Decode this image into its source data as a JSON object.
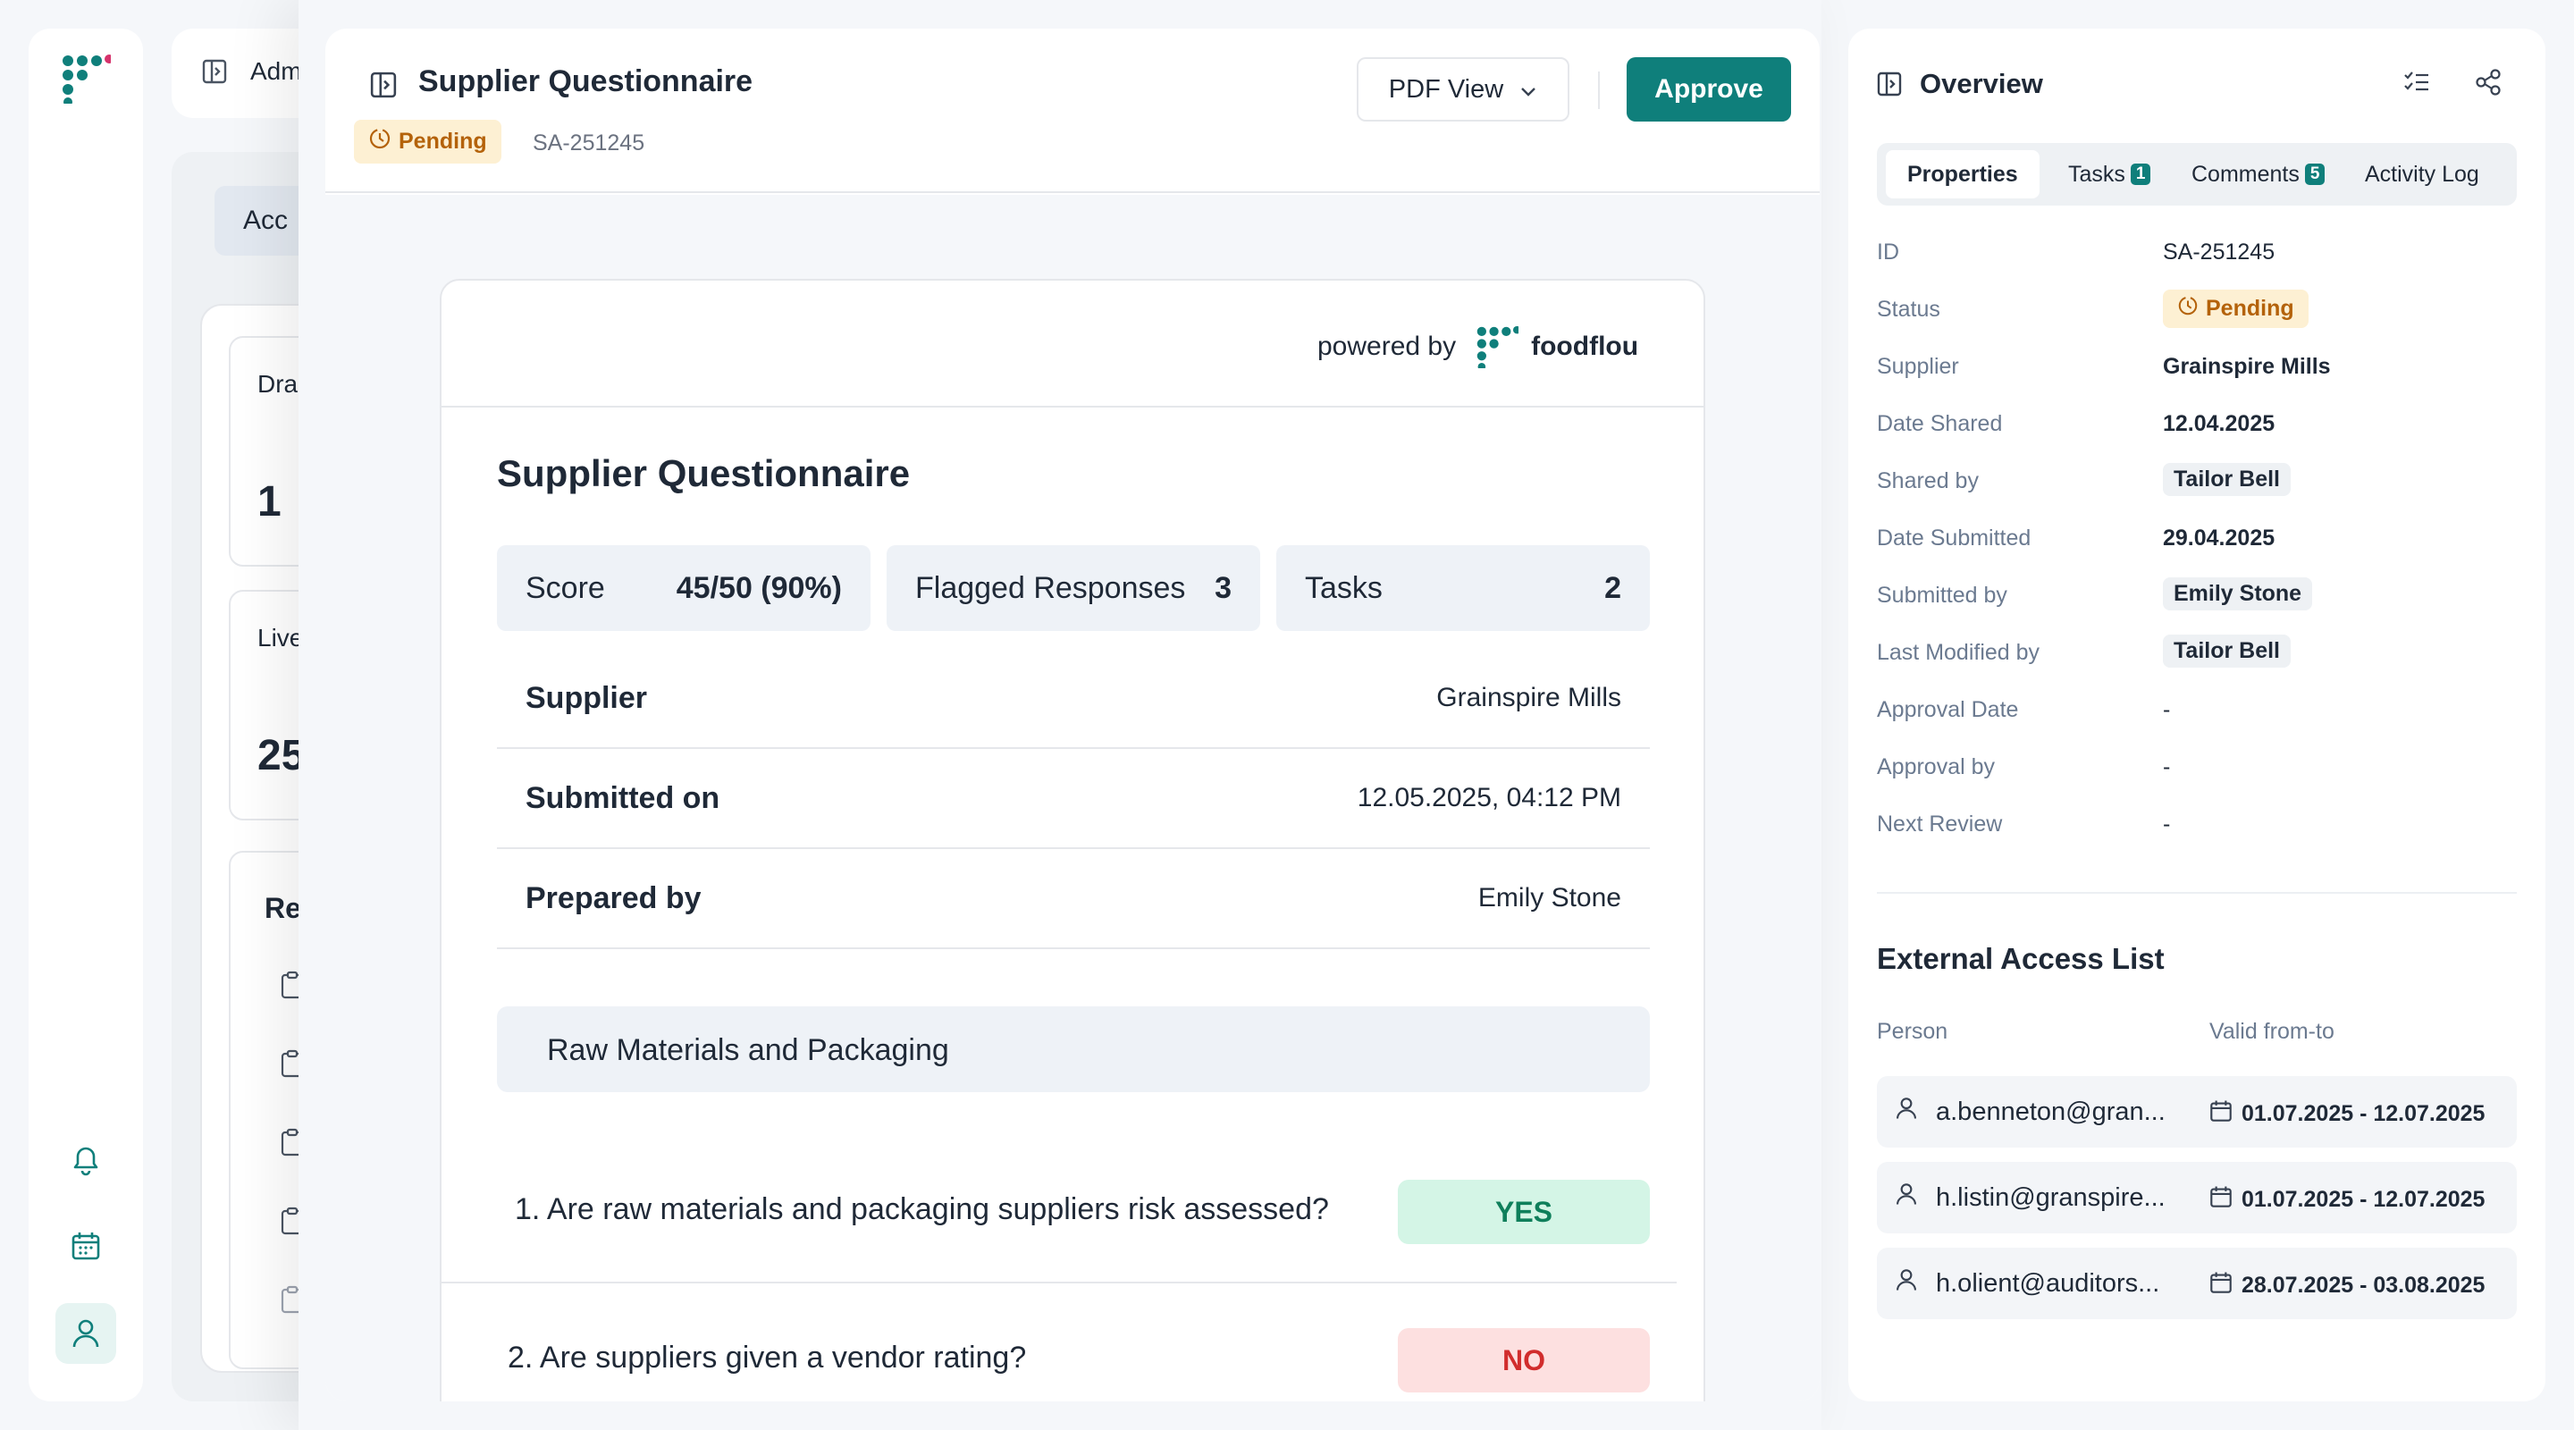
{
  "background": {
    "header_text": "Adm",
    "tab_text": "Acc",
    "card1_label": "Dra",
    "card1_value": "1",
    "card2_label": "Live",
    "card2_value": "25",
    "card3_label": "Re"
  },
  "doc": {
    "title": "Supplier Questionnaire",
    "status": "Pending",
    "id": "SA-251245",
    "pdf_view_label": "PDF View",
    "approve_label": "Approve"
  },
  "paper": {
    "powered_by": "powered by",
    "brand": "foodflou",
    "title": "Supplier Questionnaire",
    "stats": [
      {
        "label": "Score",
        "value": "45/50 (90%)"
      },
      {
        "label": "Flagged Responses",
        "value": "3"
      },
      {
        "label": "Tasks",
        "value": "2"
      }
    ],
    "info": [
      {
        "label": "Supplier",
        "value": "Grainspire Mills"
      },
      {
        "label": "Submitted on",
        "value": "12.05.2025, 04:12 PM"
      },
      {
        "label": "Prepared by",
        "value": "Emily Stone"
      }
    ],
    "section": "Raw Materials and Packaging",
    "questions": [
      {
        "text": "1. Are raw materials and packaging suppliers risk assessed?",
        "answer": "YES"
      },
      {
        "text": "2. Are suppliers given a vendor rating?",
        "answer": "NO"
      }
    ]
  },
  "overview": {
    "title": "Overview",
    "tabs": [
      {
        "label": "Properties"
      },
      {
        "label": "Tasks",
        "count": "1"
      },
      {
        "label": "Comments",
        "count": "5"
      },
      {
        "label": "Activity Log"
      }
    ],
    "properties": [
      {
        "label": "ID",
        "value": "SA-251245"
      },
      {
        "label": "Status",
        "value": "Pending"
      },
      {
        "label": "Supplier",
        "value": "Grainspire Mills"
      },
      {
        "label": "Date Shared",
        "value": "12.04.2025"
      },
      {
        "label": "Shared by",
        "value": "Tailor Bell"
      },
      {
        "label": "Date Submitted",
        "value": "29.04.2025"
      },
      {
        "label": "Submitted by",
        "value": "Emily Stone"
      },
      {
        "label": "Last Modified by",
        "value": "Tailor Bell"
      },
      {
        "label": "Approval Date",
        "value": "-"
      },
      {
        "label": "Approval by",
        "value": "-"
      },
      {
        "label": "Next Review",
        "value": "-"
      }
    ],
    "external_access": {
      "title": "External Access List",
      "col_person": "Person",
      "col_valid": "Valid from-to",
      "rows": [
        {
          "person": "a.benneton@gran...",
          "valid": "01.07.2025 - 12.07.2025"
        },
        {
          "person": "h.listin@granspire...",
          "valid": "01.07.2025 - 12.07.2025"
        },
        {
          "person": "h.olient@auditors...",
          "valid": "28.07.2025 - 03.08.2025"
        }
      ]
    }
  },
  "colors": {
    "brand": "#0f7f7b",
    "pending_bg": "#fdf0d3",
    "pending_fg": "#b4620a",
    "yes_bg": "#d4f5e6",
    "no_bg": "#fde0e0"
  }
}
